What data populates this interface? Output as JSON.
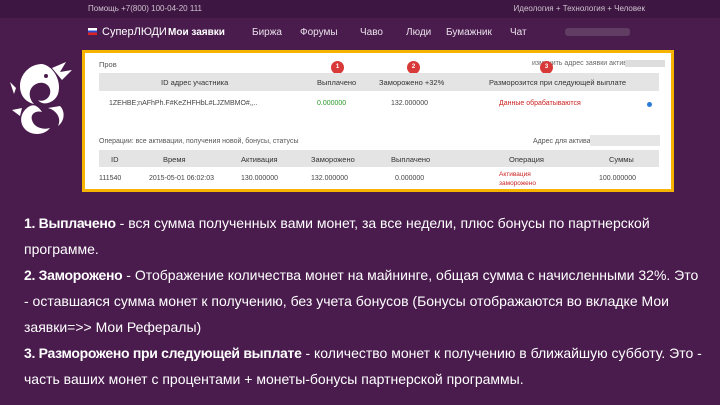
{
  "topbar": {
    "left": "Помощь   +7(800) 100-04-20 111",
    "right": "Идеология + Технология + Человек"
  },
  "nav": {
    "brand": "СуперЛЮДИ",
    "items": [
      {
        "label": "Мои заявки"
      },
      {
        "label": "Биржа"
      },
      {
        "label": "Форумы"
      },
      {
        "label": "Чаво"
      },
      {
        "label": "Люди"
      },
      {
        "label": "Бумажник"
      },
      {
        "label": "Чат"
      }
    ]
  },
  "panel": {
    "top_label": "Пров",
    "right_label": "изменить адрес заявки активна.",
    "table1": {
      "headers": [
        "ID адрес участника",
        "Выплачено",
        "Заморожено +32%",
        "Разморозится при следующей выплате"
      ],
      "row": {
        "address": "1ZEHBE;nAFhPh.F#KeZHFHbL#LJZMBMO#,,..",
        "paid": "0.000000",
        "frozen": "132.000000",
        "unfreeze": "Данные обрабатываются"
      }
    },
    "ops_label": "Операции: все  активации, получения новой, бонусы, статусы",
    "ops_right": "Адрес для активации:",
    "table2": {
      "headers": [
        "ID",
        "Время",
        "Активация",
        "Заморожено",
        "Выплачено",
        "Операция",
        "Суммы"
      ],
      "row": {
        "id": "111540",
        "time": "2015-05-01 06:02:03",
        "activation": "130.000000",
        "frozen": "132.000000",
        "paid": "0.000000",
        "operation": "Активация",
        "operation_sub": "заморожено",
        "sum": "100.000000"
      }
    },
    "badges": [
      "1",
      "2",
      "3"
    ]
  },
  "explain": {
    "p1_kw": "1. Выплачено",
    "p1_text": " - вся сумма полученных вами монет, за все недели, плюс бонусы по партнерской программе.",
    "p2_kw": "2. Заморожено",
    "p2_text": " - Отображение количества монет на майнинге, общая сумма с начисленными 32%. Это - оставшаяся сумма монет к получению, без учета бонусов (Бонусы отображаются во вкладке Мои заявки=>> Мои Рефералы)",
    "p3_kw": "3. Разморожено при следующей выплате",
    "p3_text": " - количество монет к получению в ближайшую субботу. Это - часть ваших монет с процентами + монеты-бонусы партнерской программы."
  },
  "colors": {
    "background": "#4a1c4e",
    "panel_border": "#f6b300",
    "badge": "#d83a3a",
    "paid_green": "#2a9a2a"
  }
}
